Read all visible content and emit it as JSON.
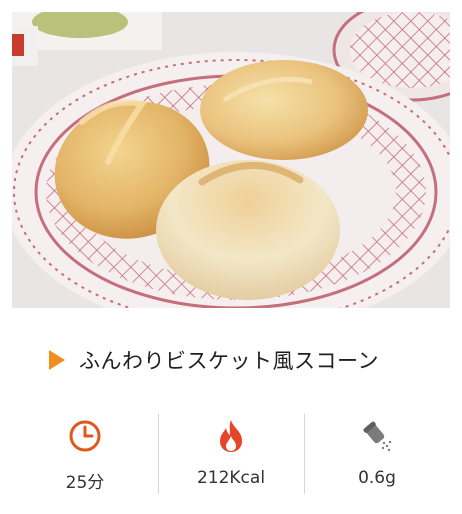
{
  "recipe": {
    "title": "ふんわりビスケット風スコーン"
  },
  "stats": [
    {
      "icon": "clock-icon",
      "value": "25分"
    },
    {
      "icon": "fire-icon",
      "value": "212Kcal"
    },
    {
      "icon": "salt-shaker-icon",
      "value": "0.6g"
    }
  ],
  "colors": {
    "accent": "#f08f1d",
    "clock": "#e2571b",
    "fire": "#e7452a",
    "plate_pattern": "#c46f7c"
  }
}
